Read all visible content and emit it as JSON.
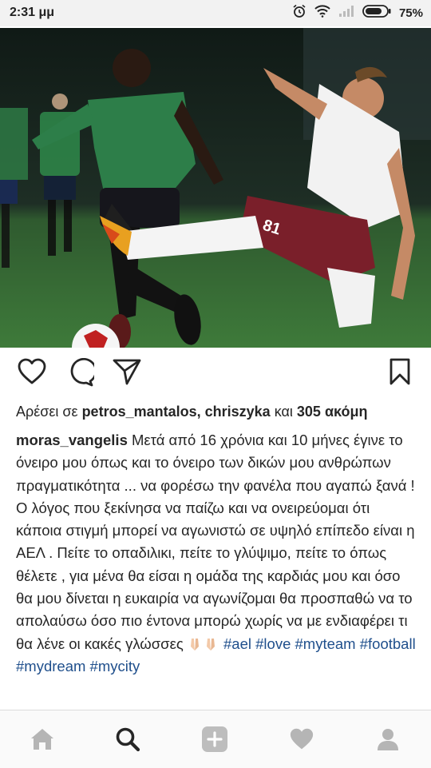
{
  "status_bar": {
    "time": "2:31 μμ",
    "battery_percent": "75%",
    "icons": [
      "alarm-icon",
      "wifi-icon",
      "signal-icon",
      "battery-icon"
    ]
  },
  "post": {
    "image": {
      "description": "football match photo",
      "jersey_number_visible": "81"
    },
    "actions": [
      "like-heart-icon",
      "comment-icon",
      "share-send-icon",
      "bookmark-icon"
    ],
    "likes": {
      "prefix": "Αρέσει σε",
      "user1": "petros_mantalos,",
      "user2": "chriszyka",
      "conj": "και",
      "more": "305 ακόμη"
    },
    "caption": {
      "username": "moras_vangelis",
      "text": "Μετά από 16 χρόνια και 10 μήνες έγινε το όνειρο μου όπως και το όνειρο των δικών μου ανθρώπων πραγματικότητα ... να φορέσω την φανέλα που αγαπώ ξανά ! Ο λόγος που ξεκίνησα να παίζω και να ονειρεύομαι ότι κάποια στιγμή μπορεί να αγωνιστώ σε υψηλό επίπεδο είναι η ΑΕΛ . Πείτε το οπαδιλικι, πείτε το γλύψιμο, πείτε το όπως θέλετε , για μένα θα είσαι η ομάδα της καρδιάς μου και όσο θα μου δίνεται η ευκαιρία να αγωνίζομαι θα προσπαθώ να το απολαύσω όσο πιο έντονα μπορώ χωρίς να με ενδιαφέρει τι θα λένε οι κακές γλώσσες",
      "emoji": "praying-hands-emoji",
      "hashtags": [
        "#ael",
        "#love",
        "#myteam",
        "#football",
        "#mydream",
        "#mycity"
      ]
    }
  },
  "bottom_nav": [
    "home-icon",
    "search-icon",
    "add-post-icon",
    "activity-heart-icon",
    "profile-icon"
  ],
  "colors": {
    "hashtag": "#1f4f8c",
    "text": "#262626",
    "nav_bg": "#fafafa",
    "status_bg": "#f2f2f2"
  }
}
